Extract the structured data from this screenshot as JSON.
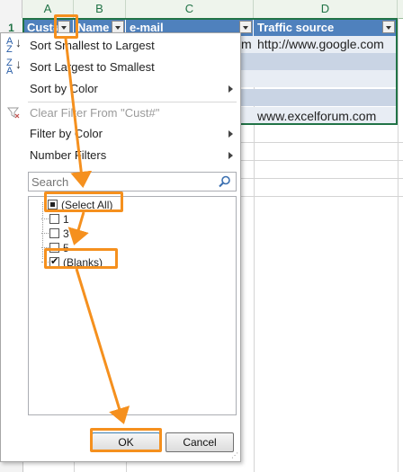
{
  "sheet": {
    "columns": [
      "A",
      "B",
      "C",
      "D"
    ],
    "rows": [
      "1"
    ],
    "table_headers": [
      "Cust#",
      "Name",
      "e-mail",
      "Traffic source"
    ],
    "cells": {
      "c2_visible": "m",
      "d2": "http://www.google.com",
      "d5": "www.excelforum.com"
    },
    "colors": {
      "header_fill": "#4f81bd",
      "band_dark": "#c9d4e4",
      "band_light": "#e8edf4",
      "accent": "#217346"
    }
  },
  "menu": {
    "items": [
      {
        "label": "Sort Smallest to Largest",
        "icon": "sort-ascending-icon",
        "enabled": true
      },
      {
        "label": "Sort Largest to Smallest",
        "icon": "sort-descending-icon",
        "enabled": true
      },
      {
        "label": "Sort by Color",
        "enabled": true,
        "submenu": true
      },
      {
        "label": "Clear Filter From \"Cust#\"",
        "icon": "clear-filter-icon",
        "enabled": false
      },
      {
        "label": "Filter by Color",
        "enabled": true,
        "submenu": true
      },
      {
        "label": "Number Filters",
        "enabled": true,
        "submenu": true
      }
    ],
    "search": {
      "placeholder": "Search",
      "value": ""
    },
    "list": [
      {
        "label": "(Select All)",
        "state": "partial"
      },
      {
        "label": "1",
        "state": "unchecked"
      },
      {
        "label": "3",
        "state": "unchecked"
      },
      {
        "label": "5",
        "state": "unchecked"
      },
      {
        "label": "(Blanks)",
        "state": "checked"
      }
    ],
    "buttons": {
      "ok": "OK",
      "cancel": "Cancel"
    }
  },
  "annotation": {
    "highlight_color": "#f5901e"
  }
}
